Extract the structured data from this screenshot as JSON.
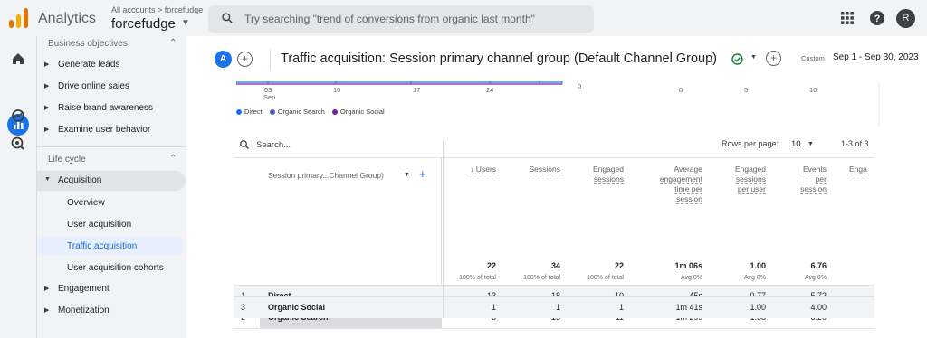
{
  "topbar": {
    "app_name": "Analytics",
    "account_crumb": "All accounts > forcefudge",
    "account_name": "forcefudge",
    "search_placeholder": "Try searching \"trend of conversions from organic last month\"",
    "avatar_letter": "R"
  },
  "sidebar": {
    "section_business": "Business objectives",
    "business_items": [
      "Generate leads",
      "Drive online sales",
      "Raise brand awareness",
      "Examine user behavior"
    ],
    "section_lifecycle": "Life cycle",
    "acquisition": "Acquisition",
    "acquisition_subs": [
      "Overview",
      "User acquisition",
      "Traffic acquisition",
      "User acquisition cohorts"
    ],
    "engagement": "Engagement",
    "monetization": "Monetization"
  },
  "report": {
    "badge": "A",
    "title": "Traffic acquisition: Session primary channel group (Default Channel Group)",
    "custom_label": "Custom",
    "date_range": "Sep 1 - Sep 30, 2023"
  },
  "chart_strip": {
    "x_ticks": [
      "03",
      "10",
      "17",
      "24"
    ],
    "x_month": "Sep",
    "right_ticks": [
      "0",
      "0",
      "5",
      "10"
    ],
    "legend": [
      {
        "name": "Direct",
        "color": "#1a73e8"
      },
      {
        "name": "Organic Search",
        "color": "#4a5fc1"
      },
      {
        "name": "Organic Social",
        "color": "#7b1fa2"
      }
    ]
  },
  "table": {
    "search_placeholder": "Search...",
    "rows_per_page_label": "Rows per page:",
    "rows_per_page_value": "10",
    "page_info": "1-3 of 3",
    "dimension_header": "Session primary...Channel Group)",
    "columns": [
      {
        "lines": [
          "↓ Users"
        ],
        "total": "22",
        "sub": "100% of total"
      },
      {
        "lines": [
          "Sessions"
        ],
        "total": "34",
        "sub": "100% of total"
      },
      {
        "lines": [
          "Engaged",
          "sessions"
        ],
        "total": "22",
        "sub": "100% of total"
      },
      {
        "lines": [
          "Average",
          "engagement",
          "time per",
          "session"
        ],
        "total": "1m 06s",
        "sub": "Avg 0%"
      },
      {
        "lines": [
          "Engaged",
          "sessions",
          "per user"
        ],
        "total": "1.00",
        "sub": "Avg 0%"
      },
      {
        "lines": [
          "Events",
          "per",
          "session"
        ],
        "total": "6.76",
        "sub": "Avg 0%"
      },
      {
        "lines": [
          "Enga"
        ],
        "total": "",
        "sub": ""
      }
    ],
    "rows": [
      {
        "idx": "1",
        "dim": "Direct",
        "cells": [
          "13",
          "18",
          "10",
          "45s",
          "0.77",
          "5.72"
        ]
      },
      {
        "idx": "2",
        "dim": "Organic Search",
        "cells": [
          "8",
          "15",
          "11",
          "1m 29s",
          "1.38",
          "8.20"
        ]
      },
      {
        "idx": "3",
        "dim": "Organic Social",
        "cells": [
          "1",
          "1",
          "1",
          "1m 41s",
          "1.00",
          "4.00"
        ]
      }
    ]
  }
}
